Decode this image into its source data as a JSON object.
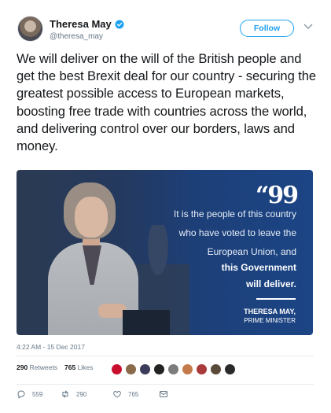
{
  "user": {
    "display_name": "Theresa May",
    "handle": "@theresa_may",
    "verified": true
  },
  "header": {
    "follow_label": "Follow"
  },
  "tweet": {
    "text": "We will deliver on the will of the British people and get the best Brexit deal for our country - securing the greatest possible access to European markets, boosting free trade with countries across the world, and delivering control over our borders, laws and money."
  },
  "media": {
    "quote_mark": "“99",
    "quote_lines": [
      "It is the people of this country",
      "who have voted to leave the",
      "European Union, and",
      "this Government",
      "will deliver."
    ],
    "attribution_name": "THERESA MAY,",
    "attribution_title": "PRIME MINISTER"
  },
  "meta": {
    "timestamp": "4:22 AM - 15 Dec 2017",
    "retweets_count": "290",
    "retweets_label": "Retweets",
    "likes_count": "765",
    "likes_label": "Likes"
  },
  "likers": [
    {
      "icon": "union-jack-avatar",
      "color": "#c8102e"
    },
    {
      "icon": "user-avatar",
      "color": "#8a6a4a"
    },
    {
      "icon": "user-avatar",
      "color": "#3b3b5a"
    },
    {
      "icon": "hat-avatar",
      "color": "#222222"
    },
    {
      "icon": "user-avatar",
      "color": "#7c7c7c"
    },
    {
      "icon": "user-avatar",
      "color": "#c47a4a"
    },
    {
      "icon": "user-avatar",
      "color": "#a83a3a"
    },
    {
      "icon": "user-avatar",
      "color": "#5a4a3a"
    },
    {
      "icon": "user-avatar",
      "color": "#2a2a2a"
    }
  ],
  "actions": {
    "reply_count": "559",
    "retweet_count": "290",
    "like_count": "765"
  },
  "colors": {
    "accent": "#1da1f2",
    "muted": "#657786",
    "card_bg": "#1d3f78"
  }
}
